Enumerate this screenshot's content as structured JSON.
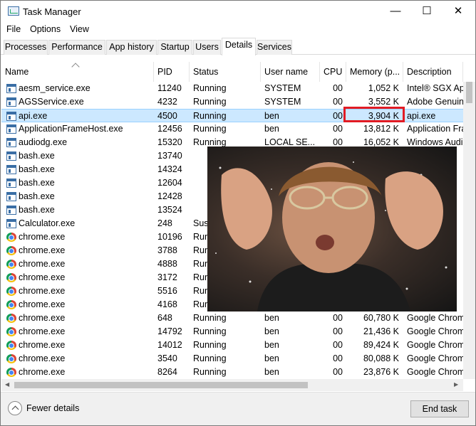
{
  "window": {
    "title": "Task Manager",
    "minimize": "—",
    "maximize": "☐",
    "close": "✕"
  },
  "menu": [
    "File",
    "Options",
    "View"
  ],
  "tabs": [
    {
      "label": "Processes",
      "active": false
    },
    {
      "label": "Performance",
      "active": false
    },
    {
      "label": "App history",
      "active": false
    },
    {
      "label": "Startup",
      "active": false
    },
    {
      "label": "Users",
      "active": false
    },
    {
      "label": "Details",
      "active": true
    },
    {
      "label": "Services",
      "active": false
    }
  ],
  "columns": [
    "Name",
    "PID",
    "Status",
    "User name",
    "CPU",
    "Memory (p...",
    "Description"
  ],
  "rows": [
    {
      "icon": "app-icon",
      "name": "aesm_service.exe",
      "pid": "11240",
      "status": "Running",
      "user": "SYSTEM",
      "cpu": "00",
      "memory": "1,052 K",
      "description": "Intel® SGX App",
      "selected": false
    },
    {
      "icon": "app-icon",
      "name": "AGSService.exe",
      "pid": "4232",
      "status": "Running",
      "user": "SYSTEM",
      "cpu": "00",
      "memory": "3,552 K",
      "description": "Adobe Genuine",
      "selected": false
    },
    {
      "icon": "app-icon",
      "name": "api.exe",
      "pid": "4500",
      "status": "Running",
      "user": "ben",
      "cpu": "00",
      "memory": "3,904 K",
      "description": "api.exe",
      "selected": true
    },
    {
      "icon": "app-icon",
      "name": "ApplicationFrameHost.exe",
      "pid": "12456",
      "status": "Running",
      "user": "ben",
      "cpu": "00",
      "memory": "13,812 K",
      "description": "Application Fra",
      "selected": false
    },
    {
      "icon": "app-icon",
      "name": "audiodg.exe",
      "pid": "15320",
      "status": "Running",
      "user": "LOCAL SE...",
      "cpu": "00",
      "memory": "16,052 K",
      "description": "Windows Audio",
      "selected": false
    },
    {
      "icon": "app-icon",
      "name": "bash.exe",
      "pid": "13740",
      "status": "",
      "user": "",
      "cpu": "",
      "memory": "",
      "description": "",
      "selected": false
    },
    {
      "icon": "app-icon",
      "name": "bash.exe",
      "pid": "14324",
      "status": "",
      "user": "",
      "cpu": "",
      "memory": "",
      "description": "",
      "selected": false
    },
    {
      "icon": "app-icon",
      "name": "bash.exe",
      "pid": "12604",
      "status": "",
      "user": "",
      "cpu": "",
      "memory": "",
      "description": "",
      "selected": false
    },
    {
      "icon": "app-icon",
      "name": "bash.exe",
      "pid": "12428",
      "status": "",
      "user": "",
      "cpu": "",
      "memory": "",
      "description": "",
      "selected": false
    },
    {
      "icon": "app-icon",
      "name": "bash.exe",
      "pid": "13524",
      "status": "",
      "user": "",
      "cpu": "",
      "memory": "",
      "description": "",
      "selected": false
    },
    {
      "icon": "app-icon",
      "name": "Calculator.exe",
      "pid": "248",
      "status": "Susp",
      "user": "",
      "cpu": "",
      "memory": "",
      "description": "",
      "selected": false
    },
    {
      "icon": "chrome-icon",
      "name": "chrome.exe",
      "pid": "10196",
      "status": "Run",
      "user": "",
      "cpu": "",
      "memory": "",
      "description": "",
      "selected": false
    },
    {
      "icon": "chrome-icon",
      "name": "chrome.exe",
      "pid": "3788",
      "status": "Run",
      "user": "",
      "cpu": "",
      "memory": "",
      "description": "",
      "selected": false
    },
    {
      "icon": "chrome-icon",
      "name": "chrome.exe",
      "pid": "4888",
      "status": "Run",
      "user": "",
      "cpu": "",
      "memory": "",
      "description": "",
      "selected": false
    },
    {
      "icon": "chrome-icon",
      "name": "chrome.exe",
      "pid": "3172",
      "status": "Run",
      "user": "",
      "cpu": "",
      "memory": "",
      "description": "",
      "selected": false
    },
    {
      "icon": "chrome-icon",
      "name": "chrome.exe",
      "pid": "5516",
      "status": "Run",
      "user": "",
      "cpu": "",
      "memory": "",
      "description": "",
      "selected": false
    },
    {
      "icon": "chrome-icon",
      "name": "chrome.exe",
      "pid": "4168",
      "status": "Run",
      "user": "",
      "cpu": "",
      "memory": "",
      "description": "",
      "selected": false
    },
    {
      "icon": "chrome-icon",
      "name": "chrome.exe",
      "pid": "648",
      "status": "Running",
      "user": "ben",
      "cpu": "00",
      "memory": "60,780 K",
      "description": "Google Chrom",
      "selected": false
    },
    {
      "icon": "chrome-icon",
      "name": "chrome.exe",
      "pid": "14792",
      "status": "Running",
      "user": "ben",
      "cpu": "00",
      "memory": "21,436 K",
      "description": "Google Chrom",
      "selected": false
    },
    {
      "icon": "chrome-icon",
      "name": "chrome.exe",
      "pid": "14012",
      "status": "Running",
      "user": "ben",
      "cpu": "00",
      "memory": "89,424 K",
      "description": "Google Chrom",
      "selected": false
    },
    {
      "icon": "chrome-icon",
      "name": "chrome.exe",
      "pid": "3540",
      "status": "Running",
      "user": "ben",
      "cpu": "00",
      "memory": "80,088 K",
      "description": "Google Chrom",
      "selected": false
    },
    {
      "icon": "chrome-icon",
      "name": "chrome.exe",
      "pid": "8264",
      "status": "Running",
      "user": "ben",
      "cpu": "00",
      "memory": "23,876 K",
      "description": "Google Chrom",
      "selected": false
    }
  ],
  "footer": {
    "fewer_details": "Fewer details",
    "end_task": "End task"
  },
  "colors": {
    "selection": "#cce8ff",
    "highlight_border": "#e21b23"
  }
}
